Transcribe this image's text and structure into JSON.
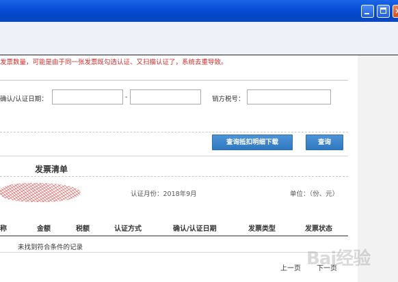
{
  "notice": "发票数量，可能是由于同一张发票既勾选认证、又扫描认证了，系统去重导致。",
  "filters": {
    "date_label": "确认/认证日期：",
    "date_from": "",
    "date_sep": "-",
    "date_to": "",
    "seller_tax_label": "销方税号：",
    "seller_tax_value": ""
  },
  "buttons": {
    "download": "查询抵扣明细下载",
    "query": "查询"
  },
  "section": {
    "title": "发票清单",
    "period": "认证月份：2018年9月",
    "unit": "单位：（份、元）"
  },
  "table": {
    "headers": [
      "称",
      "金额",
      "税额",
      "认证方式",
      "确认/认证日期",
      "发票类型",
      "发票状态"
    ],
    "empty_text": "未找到符合条件的记录"
  },
  "pager": {
    "prev": "上一页",
    "next": "下一页"
  },
  "watermark": "Bai经验",
  "icons": {
    "minimize": "minimize-icon",
    "maximize": "maximize-icon",
    "close": "close-icon"
  },
  "colors": {
    "notice": "#d62a2a",
    "button": "#3a82c8",
    "titlebar": "#0a4fd8"
  }
}
